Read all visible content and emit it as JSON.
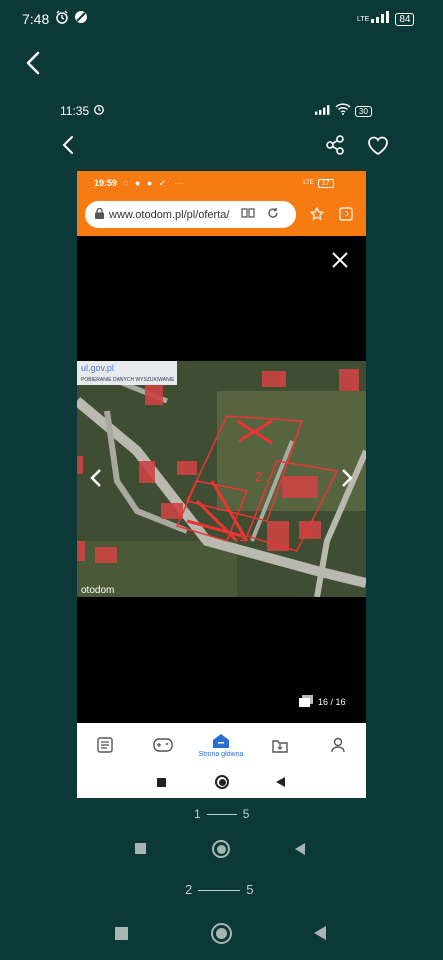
{
  "outer_status": {
    "time": "7:48",
    "network": "LTE",
    "battery": "84"
  },
  "inner_status": {
    "time": "11:35",
    "battery": "30"
  },
  "phone_status": {
    "time": "19:59",
    "dots": "···",
    "network": "LTE",
    "battery": "17"
  },
  "browser": {
    "url": "www.otodom.pl/pl/oferta/"
  },
  "map": {
    "site_text": "ul.gov.pl",
    "toolbar": "POBIERANIE DANYCH  WYSZUKIWANIE",
    "watermark": "otodom",
    "plot_labels": [
      "2",
      "1"
    ]
  },
  "gallery": {
    "counter": "16 / 16"
  },
  "nav": {
    "home_label": "Strona główna"
  },
  "pagination": [
    {
      "from": "1",
      "to": "5"
    },
    {
      "from": "2",
      "to": "5"
    }
  ],
  "colors": {
    "background": "#0c3838",
    "accent": "#f77b13",
    "blue": "#2a6fcf"
  }
}
